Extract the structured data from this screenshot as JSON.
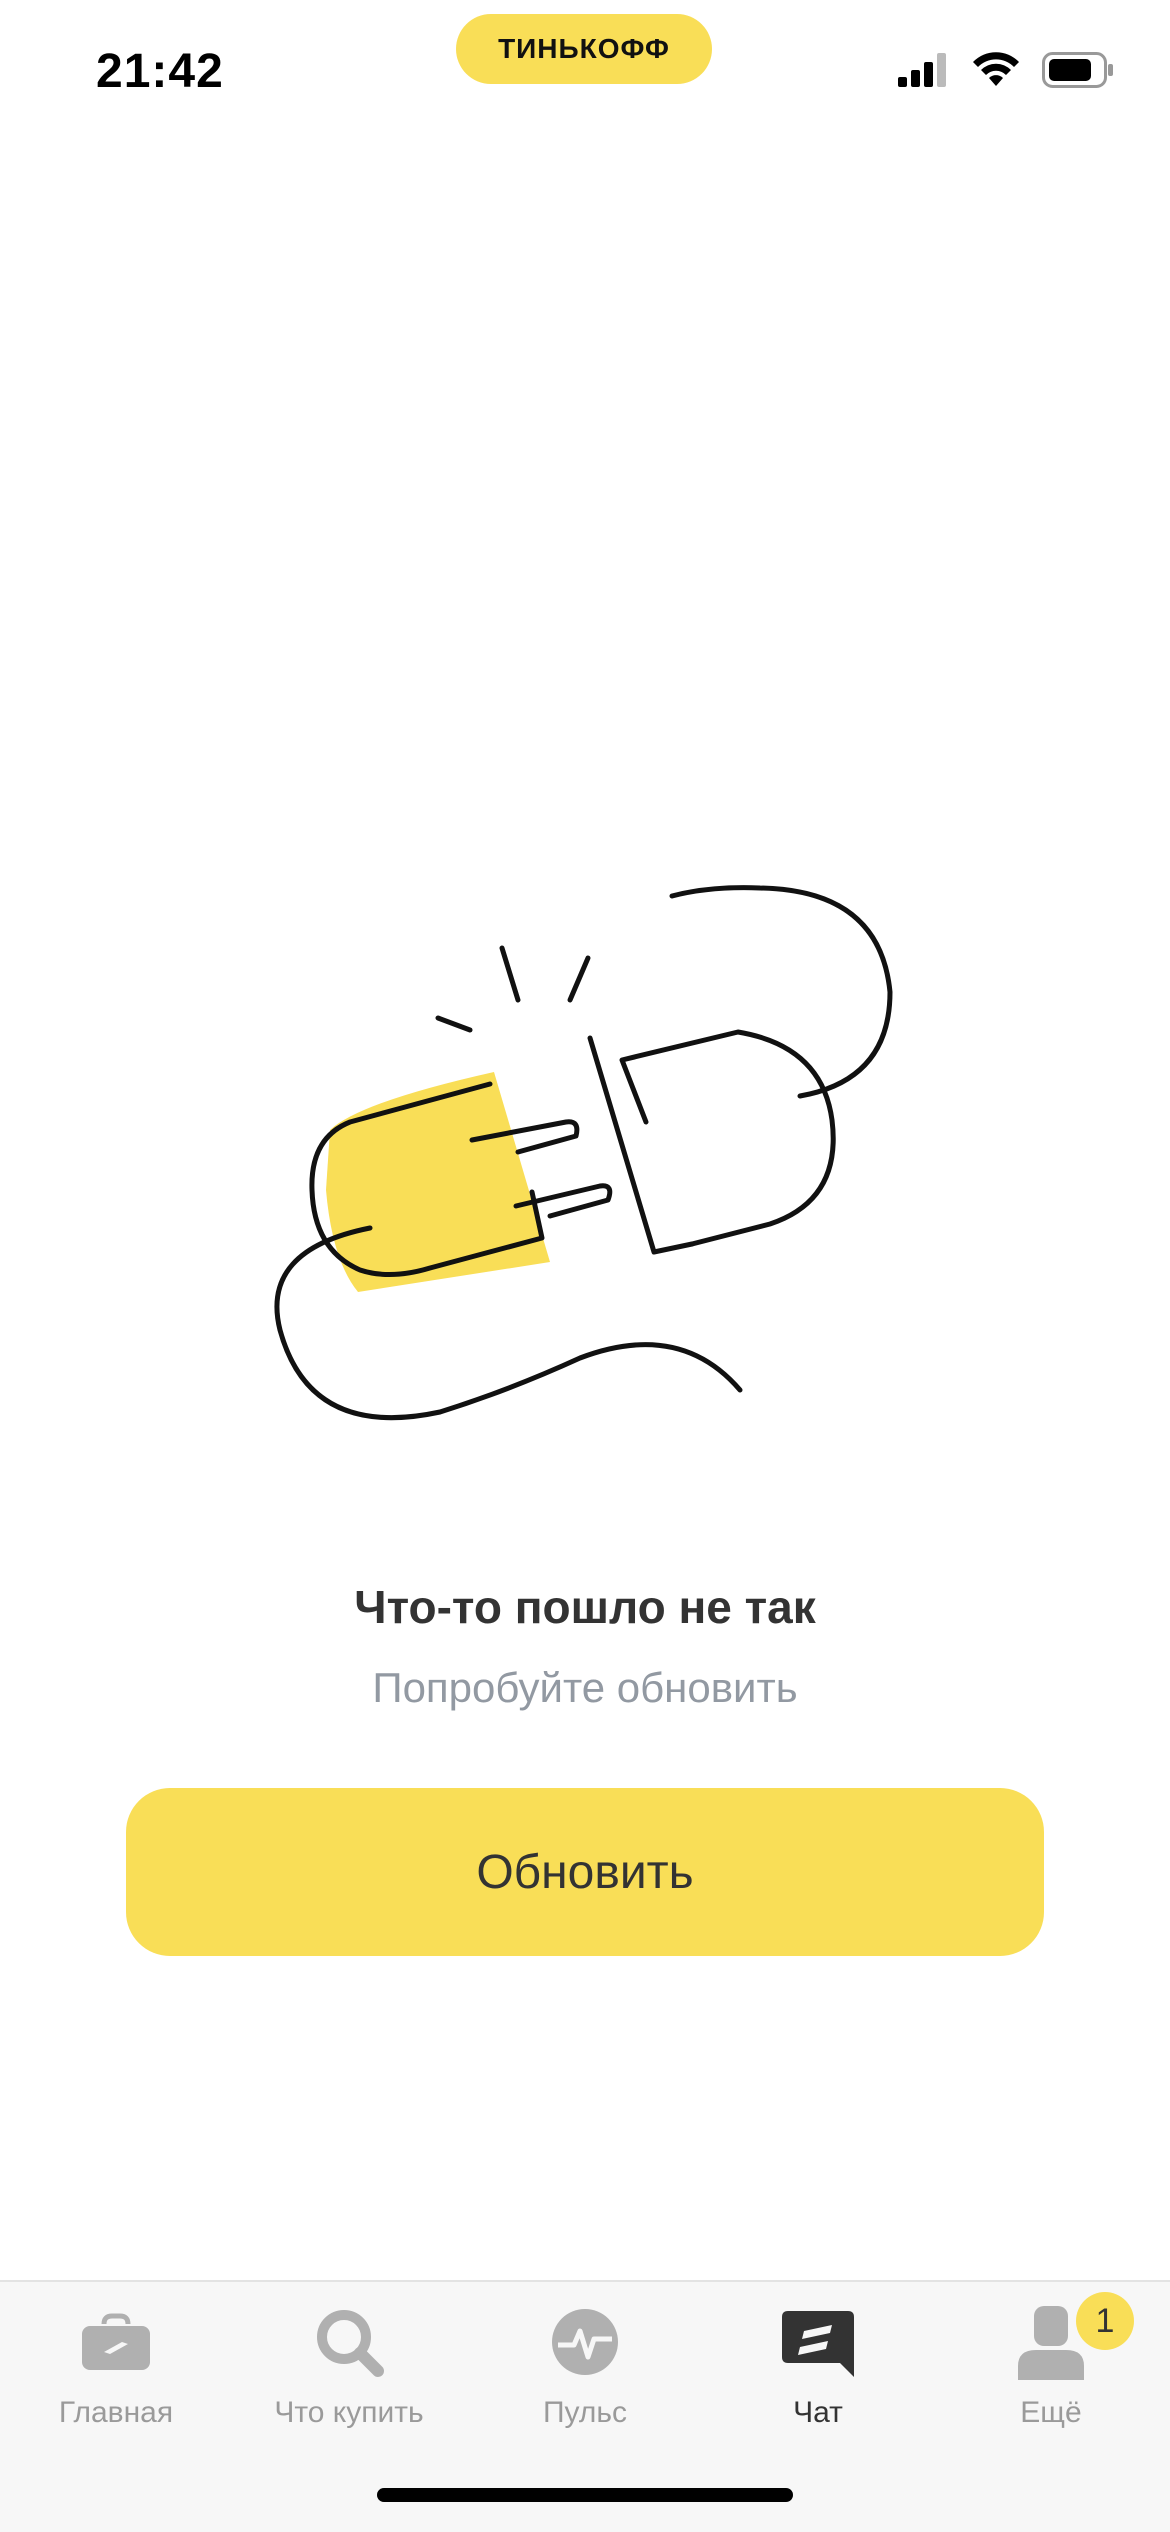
{
  "status_bar": {
    "time": "21:42",
    "brand": "ТИНЬКОФФ"
  },
  "error": {
    "title": "Что-то пошло не так",
    "subtitle": "Попробуйте обновить",
    "button_label": "Обновить"
  },
  "tabs": [
    {
      "label": "Главная",
      "icon": "briefcase-icon",
      "active": false
    },
    {
      "label": "Что купить",
      "icon": "search-icon",
      "active": false
    },
    {
      "label": "Пульс",
      "icon": "pulse-icon",
      "active": false
    },
    {
      "label": "Чат",
      "icon": "chat-icon",
      "active": true
    },
    {
      "label": "Ещё",
      "icon": "profile-icon",
      "active": false,
      "badge": "1"
    }
  ],
  "colors": {
    "accent": "#F9DE57",
    "text": "#333333",
    "muted": "#9299A2"
  }
}
